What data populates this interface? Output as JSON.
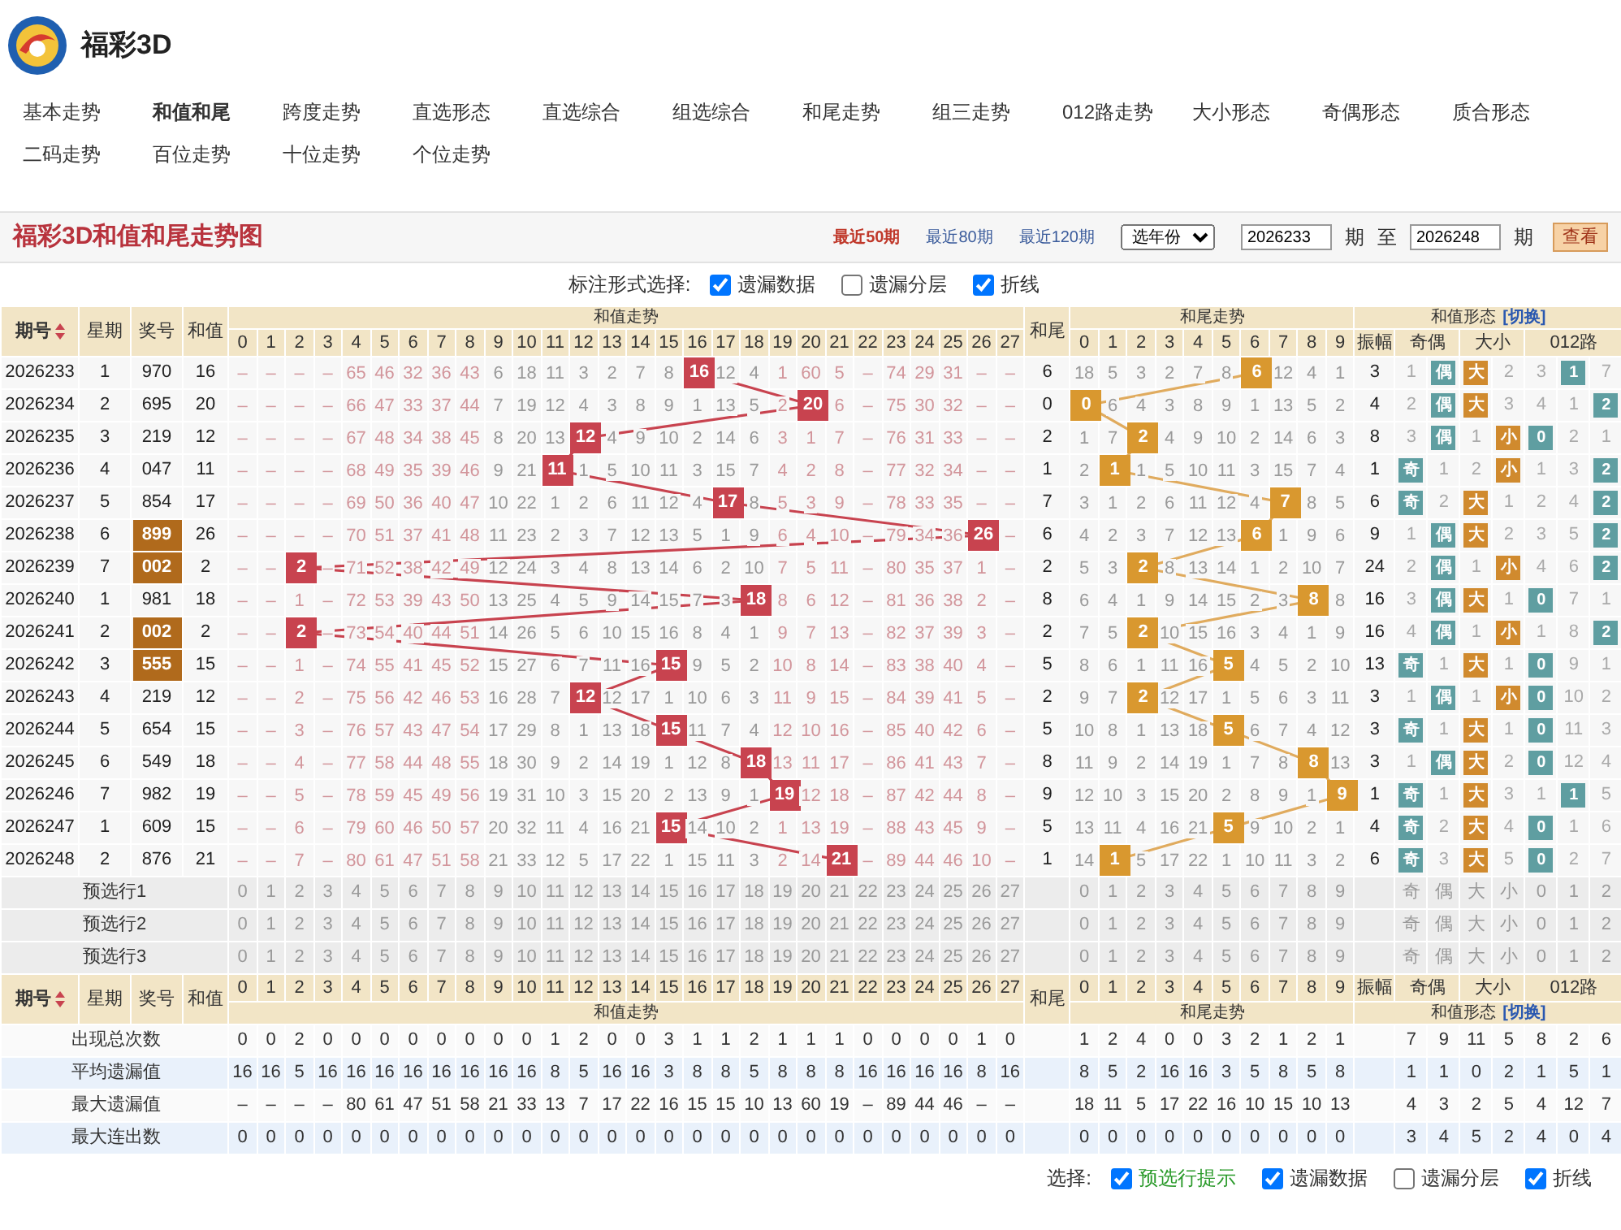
{
  "app": {
    "title": "福彩3D"
  },
  "nav": [
    {
      "label": "基本走势",
      "selected": false
    },
    {
      "label": "和值和尾",
      "selected": true
    },
    {
      "label": "跨度走势",
      "selected": false
    },
    {
      "label": "直选形态",
      "selected": false
    },
    {
      "label": "直选综合",
      "selected": false
    },
    {
      "label": "组选综合",
      "selected": false
    },
    {
      "label": "和尾走势",
      "selected": false
    },
    {
      "label": "组三走势",
      "selected": false
    },
    {
      "label": "012路走势",
      "selected": false
    },
    {
      "label": "大小形态",
      "selected": false
    },
    {
      "label": "奇偶形态",
      "selected": false
    },
    {
      "label": "质合形态",
      "selected": false
    },
    {
      "label": "二码走势",
      "selected": false
    },
    {
      "label": "百位走势",
      "selected": false
    },
    {
      "label": "十位走势",
      "selected": false
    },
    {
      "label": "个位走势",
      "selected": false
    }
  ],
  "chart_panel": {
    "title": "福彩3D和值和尾走势图",
    "ranges": [
      {
        "label": "最近50期",
        "selected": true
      },
      {
        "label": "最近80期",
        "selected": false
      },
      {
        "label": "最近120期",
        "selected": false
      }
    ],
    "year_select": "选年份",
    "from": "2026233",
    "from_unit": "期",
    "to_label": "至",
    "to": "2026248",
    "to_unit": "期",
    "view_button": "查看"
  },
  "marking": {
    "label": "标注形式选择:",
    "options": [
      {
        "label": "遗漏数据",
        "checked": true
      },
      {
        "label": "遗漏分层",
        "checked": false
      },
      {
        "label": "折线",
        "checked": true
      }
    ]
  },
  "table": {
    "header": {
      "period": "期号",
      "weekday": "星期",
      "number": "奖号",
      "sum": "和值",
      "sum_trend": "和值走势",
      "sum_columns": [
        "0",
        "1",
        "2",
        "3",
        "4",
        "5",
        "6",
        "7",
        "8",
        "9",
        "10",
        "11",
        "12",
        "13",
        "14",
        "15",
        "16",
        "17",
        "18",
        "19",
        "20",
        "21",
        "22",
        "23",
        "24",
        "25",
        "26",
        "27"
      ],
      "tail": "和尾",
      "tail_trend": "和尾走势",
      "tail_columns": [
        "0",
        "1",
        "2",
        "3",
        "4",
        "5",
        "6",
        "7",
        "8",
        "9"
      ],
      "form": "和值形态",
      "form_switch": "[切换]",
      "amplitude": "振幅",
      "odd_even": "奇偶",
      "big_small": "大小",
      "route": "012路"
    },
    "rows": [
      {
        "period": "2026233",
        "weekday": "1",
        "number": "970",
        "highlighted": false,
        "sum": "16",
        "sum_cells": [
          "–",
          "–",
          "–",
          "–",
          "65",
          "46",
          "32",
          "36",
          "43",
          "6",
          "18",
          "11",
          "3",
          "2",
          "7",
          "8",
          {
            "hit": "16"
          },
          "12",
          "4",
          "1",
          "60",
          "5",
          "–",
          "74",
          "29",
          "31",
          "–",
          "–"
        ],
        "tail": "6",
        "tail_cells": [
          "18",
          "5",
          "3",
          "2",
          "7",
          "8",
          {
            "hit": "6"
          },
          "12",
          "4",
          "1"
        ],
        "amplitude": "3",
        "form_cells": [
          "1",
          {
            "hit": "偶"
          },
          {
            "hit": "大"
          },
          "2",
          "3",
          {
            "hit": "1"
          },
          "7"
        ]
      },
      {
        "period": "2026234",
        "weekday": "2",
        "number": "695",
        "highlighted": false,
        "sum": "20",
        "sum_cells": [
          "–",
          "–",
          "–",
          "–",
          "66",
          "47",
          "33",
          "37",
          "44",
          "7",
          "19",
          "12",
          "4",
          "3",
          "8",
          "9",
          "1",
          "13",
          "5",
          "2",
          {
            "hit": "20"
          },
          "6",
          "–",
          "75",
          "30",
          "32",
          "–",
          "–"
        ],
        "tail": "0",
        "tail_cells": [
          {
            "hit": "0"
          },
          "6",
          "4",
          "3",
          "8",
          "9",
          "1",
          "13",
          "5",
          "2"
        ],
        "amplitude": "4",
        "form_cells": [
          "2",
          {
            "hit": "偶"
          },
          {
            "hit": "大"
          },
          "3",
          "4",
          "1",
          {
            "hit": "2"
          }
        ]
      },
      {
        "period": "2026235",
        "weekday": "3",
        "number": "219",
        "highlighted": false,
        "sum": "12",
        "sum_cells": [
          "–",
          "–",
          "–",
          "–",
          "67",
          "48",
          "34",
          "38",
          "45",
          "8",
          "20",
          "13",
          {
            "hit": "12"
          },
          "4",
          "9",
          "10",
          "2",
          "14",
          "6",
          "3",
          "1",
          "7",
          "–",
          "76",
          "31",
          "33",
          "–",
          "–"
        ],
        "tail": "2",
        "tail_cells": [
          "1",
          "7",
          {
            "hit": "2"
          },
          "4",
          "9",
          "10",
          "2",
          "14",
          "6",
          "3"
        ],
        "amplitude": "8",
        "form_cells": [
          "3",
          {
            "hit": "偶"
          },
          "1",
          {
            "hit": "小"
          },
          {
            "hit": "0"
          },
          "2",
          "1"
        ]
      },
      {
        "period": "2026236",
        "weekday": "4",
        "number": "047",
        "highlighted": false,
        "sum": "11",
        "sum_cells": [
          "–",
          "–",
          "–",
          "–",
          "68",
          "49",
          "35",
          "39",
          "46",
          "9",
          "21",
          {
            "hit": "11"
          },
          "1",
          "5",
          "10",
          "11",
          "3",
          "15",
          "7",
          "4",
          "2",
          "8",
          "–",
          "77",
          "32",
          "34",
          "–",
          "–"
        ],
        "tail": "1",
        "tail_cells": [
          "2",
          {
            "hit": "1"
          },
          "1",
          "5",
          "10",
          "11",
          "3",
          "15",
          "7",
          "4"
        ],
        "amplitude": "1",
        "form_cells": [
          {
            "hit": "奇"
          },
          "1",
          "2",
          {
            "hit": "小"
          },
          "1",
          "3",
          {
            "hit": "2"
          }
        ]
      },
      {
        "period": "2026237",
        "weekday": "5",
        "number": "854",
        "highlighted": false,
        "sum": "17",
        "sum_cells": [
          "–",
          "–",
          "–",
          "–",
          "69",
          "50",
          "36",
          "40",
          "47",
          "10",
          "22",
          "1",
          "2",
          "6",
          "11",
          "12",
          "4",
          {
            "hit": "17"
          },
          "8",
          "5",
          "3",
          "9",
          "–",
          "78",
          "33",
          "35",
          "–",
          "–"
        ],
        "tail": "7",
        "tail_cells": [
          "3",
          "1",
          "2",
          "6",
          "11",
          "12",
          "4",
          {
            "hit": "7"
          },
          "8",
          "5"
        ],
        "amplitude": "6",
        "form_cells": [
          {
            "hit": "奇"
          },
          "2",
          {
            "hit": "大"
          },
          "1",
          "2",
          "4",
          {
            "hit": "2"
          }
        ]
      },
      {
        "period": "2026238",
        "weekday": "6",
        "number": "899",
        "highlighted": true,
        "sum": "26",
        "sum_cells": [
          "–",
          "–",
          "–",
          "–",
          "70",
          "51",
          "37",
          "41",
          "48",
          "11",
          "23",
          "2",
          "3",
          "7",
          "12",
          "13",
          "5",
          "1",
          "9",
          "6",
          "4",
          "10",
          "–",
          "79",
          "34",
          "36",
          {
            "hit": "26"
          },
          "–"
        ],
        "tail": "6",
        "tail_cells": [
          "4",
          "2",
          "3",
          "7",
          "12",
          "13",
          {
            "hit": "6"
          },
          "1",
          "9",
          "6"
        ],
        "amplitude": "9",
        "form_cells": [
          "1",
          {
            "hit": "偶"
          },
          {
            "hit": "大"
          },
          "2",
          "3",
          "5",
          {
            "hit": "2"
          }
        ]
      },
      {
        "period": "2026239",
        "weekday": "7",
        "number": "002",
        "highlighted": true,
        "sum": "2",
        "sum_cells": [
          "–",
          "–",
          {
            "hit": "2"
          },
          "–",
          "71",
          "52",
          "38",
          "42",
          "49",
          "12",
          "24",
          "3",
          "4",
          "8",
          "13",
          "14",
          "6",
          "2",
          "10",
          "7",
          "5",
          "11",
          "–",
          "80",
          "35",
          "37",
          "1",
          "–"
        ],
        "tail": "2",
        "tail_cells": [
          "5",
          "3",
          {
            "hit": "2"
          },
          "8",
          "13",
          "14",
          "1",
          "2",
          "10",
          "7"
        ],
        "amplitude": "24",
        "form_cells": [
          "2",
          {
            "hit": "偶"
          },
          "1",
          {
            "hit": "小"
          },
          "4",
          "6",
          {
            "hit": "2"
          }
        ]
      },
      {
        "period": "2026240",
        "weekday": "1",
        "number": "981",
        "highlighted": false,
        "sum": "18",
        "sum_cells": [
          "–",
          "–",
          "1",
          "–",
          "72",
          "53",
          "39",
          "43",
          "50",
          "13",
          "25",
          "4",
          "5",
          "9",
          "14",
          "15",
          "7",
          "3",
          {
            "hit": "18"
          },
          "8",
          "6",
          "12",
          "–",
          "81",
          "36",
          "38",
          "2",
          "–"
        ],
        "tail": "8",
        "tail_cells": [
          "6",
          "4",
          "1",
          "9",
          "14",
          "15",
          "2",
          "3",
          {
            "hit": "8"
          },
          "8"
        ],
        "amplitude": "16",
        "form_cells": [
          "3",
          {
            "hit": "偶"
          },
          {
            "hit": "大"
          },
          "1",
          {
            "hit": "0"
          },
          "7",
          "1"
        ]
      },
      {
        "period": "2026241",
        "weekday": "2",
        "number": "002",
        "highlighted": true,
        "sum": "2",
        "sum_cells": [
          "–",
          "–",
          {
            "hit": "2"
          },
          "–",
          "73",
          "54",
          "40",
          "44",
          "51",
          "14",
          "26",
          "5",
          "6",
          "10",
          "15",
          "16",
          "8",
          "4",
          "1",
          "9",
          "7",
          "13",
          "–",
          "82",
          "37",
          "39",
          "3",
          "–"
        ],
        "tail": "2",
        "tail_cells": [
          "7",
          "5",
          {
            "hit": "2"
          },
          "10",
          "15",
          "16",
          "3",
          "4",
          "1",
          "9"
        ],
        "amplitude": "16",
        "form_cells": [
          "4",
          {
            "hit": "偶"
          },
          "1",
          {
            "hit": "小"
          },
          "1",
          "8",
          {
            "hit": "2"
          }
        ]
      },
      {
        "period": "2026242",
        "weekday": "3",
        "number": "555",
        "highlighted": true,
        "sum": "15",
        "sum_cells": [
          "–",
          "–",
          "1",
          "–",
          "74",
          "55",
          "41",
          "45",
          "52",
          "15",
          "27",
          "6",
          "7",
          "11",
          "16",
          {
            "hit": "15"
          },
          "9",
          "5",
          "2",
          "10",
          "8",
          "14",
          "–",
          "83",
          "38",
          "40",
          "4",
          "–"
        ],
        "tail": "5",
        "tail_cells": [
          "8",
          "6",
          "1",
          "11",
          "16",
          {
            "hit": "5"
          },
          "4",
          "5",
          "2",
          "10"
        ],
        "amplitude": "13",
        "form_cells": [
          {
            "hit": "奇"
          },
          "1",
          {
            "hit": "大"
          },
          "1",
          {
            "hit": "0"
          },
          "9",
          "1"
        ]
      },
      {
        "period": "2026243",
        "weekday": "4",
        "number": "219",
        "highlighted": false,
        "sum": "12",
        "sum_cells": [
          "–",
          "–",
          "2",
          "–",
          "75",
          "56",
          "42",
          "46",
          "53",
          "16",
          "28",
          "7",
          {
            "hit": "12"
          },
          "12",
          "17",
          "1",
          "10",
          "6",
          "3",
          "11",
          "9",
          "15",
          "–",
          "84",
          "39",
          "41",
          "5",
          "–"
        ],
        "tail": "2",
        "tail_cells": [
          "9",
          "7",
          {
            "hit": "2"
          },
          "12",
          "17",
          "1",
          "5",
          "6",
          "3",
          "11"
        ],
        "amplitude": "3",
        "form_cells": [
          "1",
          {
            "hit": "偶"
          },
          "1",
          {
            "hit": "小"
          },
          {
            "hit": "0"
          },
          "10",
          "2"
        ]
      },
      {
        "period": "2026244",
        "weekday": "5",
        "number": "654",
        "highlighted": false,
        "sum": "15",
        "sum_cells": [
          "–",
          "–",
          "3",
          "–",
          "76",
          "57",
          "43",
          "47",
          "54",
          "17",
          "29",
          "8",
          "1",
          "13",
          "18",
          {
            "hit": "15"
          },
          "11",
          "7",
          "4",
          "12",
          "10",
          "16",
          "–",
          "85",
          "40",
          "42",
          "6",
          "–"
        ],
        "tail": "5",
        "tail_cells": [
          "10",
          "8",
          "1",
          "13",
          "18",
          {
            "hit": "5"
          },
          "6",
          "7",
          "4",
          "12"
        ],
        "amplitude": "3",
        "form_cells": [
          {
            "hit": "奇"
          },
          "1",
          {
            "hit": "大"
          },
          "1",
          {
            "hit": "0"
          },
          "11",
          "3"
        ]
      },
      {
        "period": "2026245",
        "weekday": "6",
        "number": "549",
        "highlighted": false,
        "sum": "18",
        "sum_cells": [
          "–",
          "–",
          "4",
          "–",
          "77",
          "58",
          "44",
          "48",
          "55",
          "18",
          "30",
          "9",
          "2",
          "14",
          "19",
          "1",
          "12",
          "8",
          {
            "hit": "18"
          },
          "13",
          "11",
          "17",
          "–",
          "86",
          "41",
          "43",
          "7",
          "–"
        ],
        "tail": "8",
        "tail_cells": [
          "11",
          "9",
          "2",
          "14",
          "19",
          "1",
          "7",
          "8",
          {
            "hit": "8"
          },
          "13"
        ],
        "amplitude": "3",
        "form_cells": [
          "1",
          {
            "hit": "偶"
          },
          {
            "hit": "大"
          },
          "2",
          {
            "hit": "0"
          },
          "12",
          "4"
        ]
      },
      {
        "period": "2026246",
        "weekday": "7",
        "number": "982",
        "highlighted": false,
        "sum": "19",
        "sum_cells": [
          "–",
          "–",
          "5",
          "–",
          "78",
          "59",
          "45",
          "49",
          "56",
          "19",
          "31",
          "10",
          "3",
          "15",
          "20",
          "2",
          "13",
          "9",
          "1",
          {
            "hit": "19"
          },
          "12",
          "18",
          "–",
          "87",
          "42",
          "44",
          "8",
          "–"
        ],
        "tail": "9",
        "tail_cells": [
          "12",
          "10",
          "3",
          "15",
          "20",
          "2",
          "8",
          "9",
          "1",
          {
            "hit": "9"
          }
        ],
        "amplitude": "1",
        "form_cells": [
          {
            "hit": "奇"
          },
          "1",
          {
            "hit": "大"
          },
          "3",
          "1",
          {
            "hit": "1"
          },
          "5"
        ]
      },
      {
        "period": "2026247",
        "weekday": "1",
        "number": "609",
        "highlighted": false,
        "sum": "15",
        "sum_cells": [
          "–",
          "–",
          "6",
          "–",
          "79",
          "60",
          "46",
          "50",
          "57",
          "20",
          "32",
          "11",
          "4",
          "16",
          "21",
          {
            "hit": "15"
          },
          "14",
          "10",
          "2",
          "1",
          "13",
          "19",
          "–",
          "88",
          "43",
          "45",
          "9",
          "–"
        ],
        "tail": "5",
        "tail_cells": [
          "13",
          "11",
          "4",
          "16",
          "21",
          {
            "hit": "5"
          },
          "9",
          "10",
          "2",
          "1"
        ],
        "amplitude": "4",
        "form_cells": [
          {
            "hit": "奇"
          },
          "2",
          {
            "hit": "大"
          },
          "4",
          {
            "hit": "0"
          },
          "1",
          "6"
        ]
      },
      {
        "period": "2026248",
        "weekday": "2",
        "number": "876",
        "highlighted": false,
        "sum": "21",
        "sum_cells": [
          "–",
          "–",
          "7",
          "–",
          "80",
          "61",
          "47",
          "51",
          "58",
          "21",
          "33",
          "12",
          "5",
          "17",
          "22",
          "1",
          "15",
          "11",
          "3",
          "2",
          "14",
          {
            "hit": "21"
          },
          "–",
          "89",
          "44",
          "46",
          "10",
          "–"
        ],
        "tail": "1",
        "tail_cells": [
          "14",
          {
            "hit": "1"
          },
          "5",
          "17",
          "22",
          "1",
          "10",
          "11",
          "3",
          "2"
        ],
        "amplitude": "6",
        "form_cells": [
          {
            "hit": "奇"
          },
          "3",
          {
            "hit": "大"
          },
          "5",
          {
            "hit": "0"
          },
          "2",
          "7"
        ]
      }
    ],
    "preselect_rows": [
      {
        "label": "预选行1",
        "sum_cells": [
          "0",
          "1",
          "2",
          "3",
          "4",
          "5",
          "6",
          "7",
          "8",
          "9",
          "10",
          "11",
          "12",
          "13",
          "14",
          "15",
          "16",
          "17",
          "18",
          "19",
          "20",
          "21",
          "22",
          "23",
          "24",
          "25",
          "26",
          "27"
        ],
        "tail_cells": [
          "0",
          "1",
          "2",
          "3",
          "4",
          "5",
          "6",
          "7",
          "8",
          "9"
        ],
        "form_cells": [
          "奇",
          "偶",
          "大",
          "小",
          "0",
          "1",
          "2"
        ]
      },
      {
        "label": "预选行2",
        "sum_cells": [
          "0",
          "1",
          "2",
          "3",
          "4",
          "5",
          "6",
          "7",
          "8",
          "9",
          "10",
          "11",
          "12",
          "13",
          "14",
          "15",
          "16",
          "17",
          "18",
          "19",
          "20",
          "21",
          "22",
          "23",
          "24",
          "25",
          "26",
          "27"
        ],
        "tail_cells": [
          "0",
          "1",
          "2",
          "3",
          "4",
          "5",
          "6",
          "7",
          "8",
          "9"
        ],
        "form_cells": [
          "奇",
          "偶",
          "大",
          "小",
          "0",
          "1",
          "2"
        ]
      },
      {
        "label": "预选行3",
        "sum_cells": [
          "0",
          "1",
          "2",
          "3",
          "4",
          "5",
          "6",
          "7",
          "8",
          "9",
          "10",
          "11",
          "12",
          "13",
          "14",
          "15",
          "16",
          "17",
          "18",
          "19",
          "20",
          "21",
          "22",
          "23",
          "24",
          "25",
          "26",
          "27"
        ],
        "tail_cells": [
          "0",
          "1",
          "2",
          "3",
          "4",
          "5",
          "6",
          "7",
          "8",
          "9"
        ],
        "form_cells": [
          "奇",
          "偶",
          "大",
          "小",
          "0",
          "1",
          "2"
        ]
      }
    ],
    "footer_header": {
      "period": "期号",
      "weekday": "星期",
      "number": "奖号",
      "sum": "和值",
      "sum_trend": "和值走势",
      "sum_columns": [
        "0",
        "1",
        "2",
        "3",
        "4",
        "5",
        "6",
        "7",
        "8",
        "9",
        "10",
        "11",
        "12",
        "13",
        "14",
        "15",
        "16",
        "17",
        "18",
        "19",
        "20",
        "21",
        "22",
        "23",
        "24",
        "25",
        "26",
        "27"
      ],
      "tail": "和尾",
      "tail_trend": "和尾走势",
      "tail_columns": [
        "0",
        "1",
        "2",
        "3",
        "4",
        "5",
        "6",
        "7",
        "8",
        "9"
      ],
      "form": "和值形态",
      "form_switch": "[切换]",
      "amplitude": "振幅",
      "odd_even": "奇偶",
      "big_small": "大小",
      "route": "012路"
    },
    "stats": [
      {
        "label": "出现总次数",
        "sum_cells": [
          "0",
          "0",
          "2",
          "0",
          "0",
          "0",
          "0",
          "0",
          "0",
          "0",
          "0",
          "1",
          "2",
          "0",
          "0",
          "3",
          "1",
          "1",
          "2",
          "1",
          "1",
          "1",
          "0",
          "0",
          "0",
          "0",
          "1",
          "0"
        ],
        "tail_cells": [
          "1",
          "2",
          "4",
          "0",
          "0",
          "3",
          "2",
          "1",
          "2",
          "1"
        ],
        "form_cells": [
          "7",
          "9",
          "11",
          "5",
          "8",
          "2",
          "6"
        ]
      },
      {
        "label": "平均遗漏值",
        "sum_cells": [
          "16",
          "16",
          "5",
          "16",
          "16",
          "16",
          "16",
          "16",
          "16",
          "16",
          "16",
          "8",
          "5",
          "16",
          "16",
          "3",
          "8",
          "8",
          "5",
          "8",
          "8",
          "8",
          "16",
          "16",
          "16",
          "16",
          "8",
          "16"
        ],
        "tail_cells": [
          "8",
          "5",
          "2",
          "16",
          "16",
          "3",
          "5",
          "8",
          "5",
          "8"
        ],
        "form_cells": [
          "1",
          "1",
          "0",
          "2",
          "1",
          "5",
          "1"
        ]
      },
      {
        "label": "最大遗漏值",
        "sum_cells": [
          "–",
          "–",
          "–",
          "–",
          "80",
          "61",
          "47",
          "51",
          "58",
          "21",
          "33",
          "13",
          "7",
          "17",
          "22",
          "16",
          "15",
          "15",
          "10",
          "13",
          "60",
          "19",
          "–",
          "89",
          "44",
          "46",
          "–",
          "–"
        ],
        "tail_cells": [
          "18",
          "11",
          "5",
          "17",
          "22",
          "16",
          "10",
          "15",
          "10",
          "13"
        ],
        "form_cells": [
          "4",
          "3",
          "2",
          "5",
          "4",
          "12",
          "7"
        ]
      },
      {
        "label": "最大连出数",
        "sum_cells": [
          "0",
          "0",
          "0",
          "0",
          "0",
          "0",
          "0",
          "0",
          "0",
          "0",
          "0",
          "0",
          "0",
          "0",
          "0",
          "0",
          "0",
          "0",
          "0",
          "0",
          "0",
          "0",
          "0",
          "0",
          "0",
          "0",
          "0",
          "0"
        ],
        "tail_cells": [
          "0",
          "0",
          "0",
          "0",
          "0",
          "0",
          "0",
          "0",
          "0",
          "0"
        ],
        "form_cells": [
          "3",
          "4",
          "5",
          "2",
          "4",
          "0",
          "4"
        ]
      }
    ]
  },
  "options": {
    "label": "选择:",
    "items": [
      {
        "label": "预选行提示",
        "checked": true
      },
      {
        "label": "遗漏数据",
        "checked": true
      },
      {
        "label": "遗漏分层",
        "checked": false
      },
      {
        "label": "折线",
        "checked": true
      }
    ]
  }
}
